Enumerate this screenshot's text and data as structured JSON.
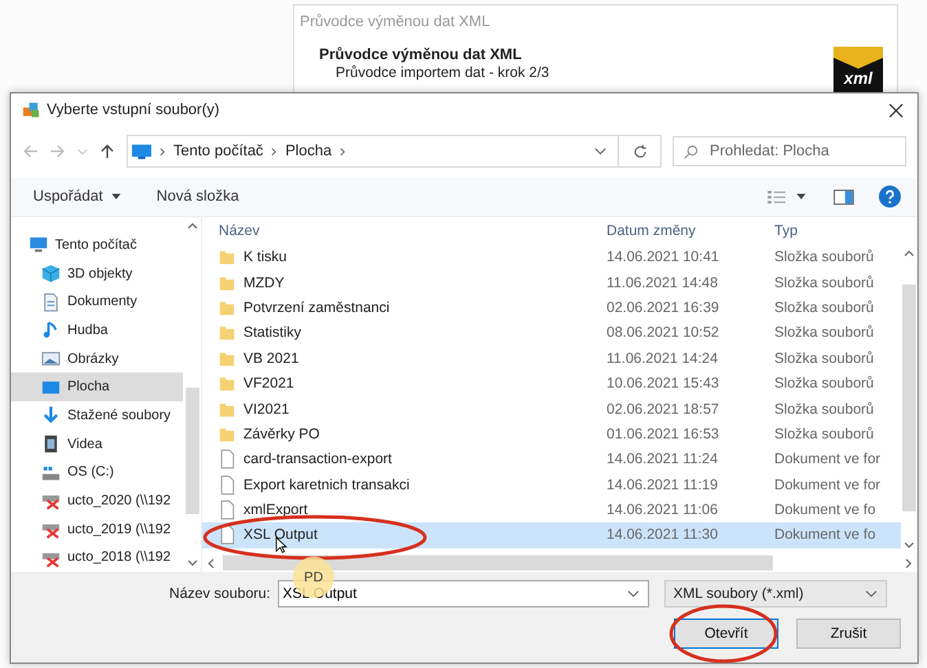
{
  "wizard": {
    "title": "Průvodce výměnou dat XML",
    "heading": "Průvodce výměnou dat XML",
    "subtitle": "Průvodce importem dat - krok 2/3",
    "logo": "xml"
  },
  "dialog": {
    "title": "Vyberte vstupní soubor(y)",
    "breadcrumb": [
      "Tento počítač",
      "Plocha"
    ],
    "search": {
      "placeholder": "Prohledat: Plocha"
    },
    "toolbar": {
      "organize": "Uspořádat",
      "new_folder": "Nová složka"
    },
    "sidebar": [
      {
        "kind": "pc",
        "label": "Tento počítač",
        "selected": false
      },
      {
        "kind": "cube",
        "label": "3D objekty",
        "selected": false
      },
      {
        "kind": "doc",
        "label": "Dokumenty",
        "selected": false
      },
      {
        "kind": "music",
        "label": "Hudba",
        "selected": false
      },
      {
        "kind": "image",
        "label": "Obrázky",
        "selected": false
      },
      {
        "kind": "desktop",
        "label": "Plocha",
        "selected": true
      },
      {
        "kind": "download",
        "label": "Stažené soubory",
        "selected": false
      },
      {
        "kind": "video",
        "label": "Videa",
        "selected": false
      },
      {
        "kind": "drive",
        "label": "OS (C:)",
        "selected": false
      },
      {
        "kind": "netdrive",
        "label": "ucto_2020 (\\\\192",
        "selected": false
      },
      {
        "kind": "netdrive",
        "label": "ucto_2019 (\\\\192",
        "selected": false
      },
      {
        "kind": "netdrive",
        "label": "ucto_2018 (\\\\192",
        "selected": false
      }
    ],
    "columns": [
      "Název",
      "Datum změny",
      "Typ"
    ],
    "files": [
      {
        "kind": "folder",
        "name": "K tisku",
        "date": "14.06.2021 10:41",
        "type": "Složka souborů",
        "selected": false
      },
      {
        "kind": "folder",
        "name": "MZDY",
        "date": "11.06.2021 14:48",
        "type": "Složka souborů",
        "selected": false
      },
      {
        "kind": "folder",
        "name": "Potvrzení zaměstnanci",
        "date": "02.06.2021 16:39",
        "type": "Složka souborů",
        "selected": false
      },
      {
        "kind": "folder",
        "name": "Statistiky",
        "date": "08.06.2021 10:52",
        "type": "Složka souborů",
        "selected": false
      },
      {
        "kind": "folder",
        "name": "VB 2021",
        "date": "11.06.2021 14:24",
        "type": "Složka souborů",
        "selected": false
      },
      {
        "kind": "folder",
        "name": "VF2021",
        "date": "10.06.2021 15:43",
        "type": "Složka souborů",
        "selected": false
      },
      {
        "kind": "folder",
        "name": "VI2021",
        "date": "02.06.2021 18:57",
        "type": "Složka souborů",
        "selected": false
      },
      {
        "kind": "folder",
        "name": "Závěrky PO",
        "date": "01.06.2021 16:53",
        "type": "Složka souborů",
        "selected": false
      },
      {
        "kind": "file",
        "name": "card-transaction-export",
        "date": "14.06.2021 11:24",
        "type": "Dokument ve for",
        "selected": false
      },
      {
        "kind": "file",
        "name": "Export karetnich transakci",
        "date": "14.06.2021 11:19",
        "type": "Dokument ve for",
        "selected": false
      },
      {
        "kind": "file",
        "name": "xmlExport",
        "date": "14.06.2021 11:06",
        "type": "Dokument ve fo",
        "selected": false
      },
      {
        "kind": "file",
        "name": "XSL Output",
        "date": "14.06.2021 11:30",
        "type": "Dokument ve fo",
        "selected": true
      }
    ],
    "filename_label": "Název souboru:",
    "filename_value": "XSL Output",
    "filter": "XML soubory (*.xml)",
    "open_button": "Otevřít",
    "cancel_button": "Zrušit"
  },
  "cursor_badge": "PD"
}
